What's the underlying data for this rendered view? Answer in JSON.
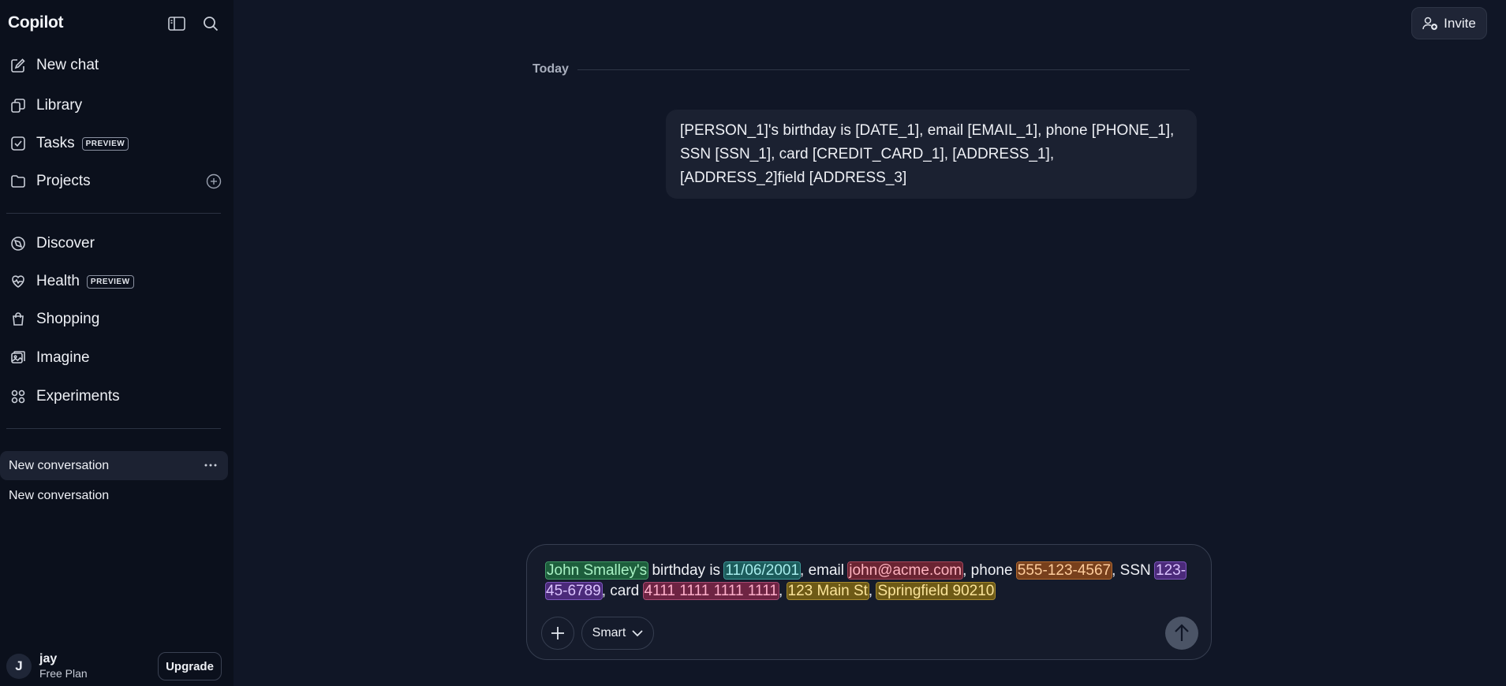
{
  "sidebar": {
    "brand": "Copilot",
    "top_icons": [
      "sidebar-toggle-icon",
      "search-icon"
    ],
    "nav": [
      {
        "label": "New chat",
        "icon": "compose-icon"
      },
      {
        "label": "Library",
        "icon": "library-icon"
      },
      {
        "label": "Tasks",
        "icon": "tasks-icon",
        "badge": "PREVIEW"
      },
      {
        "label": "Projects",
        "icon": "folder-icon"
      },
      {
        "label": "Discover",
        "icon": "compass-icon"
      },
      {
        "label": "Health",
        "icon": "heart-icon",
        "badge": "PREVIEW"
      },
      {
        "label": "Shopping",
        "icon": "shopping-bag-icon"
      },
      {
        "label": "Imagine",
        "icon": "image-icon"
      },
      {
        "label": "Experiments",
        "icon": "experiments-icon"
      }
    ],
    "conversations": [
      {
        "label": "New conversation",
        "active": true
      },
      {
        "label": "New conversation",
        "active": false
      }
    ],
    "user": {
      "initial": "J",
      "name": "jay",
      "plan": "Free Plan"
    },
    "upgrade_label": "Upgrade"
  },
  "header": {
    "invite_label": "Invite"
  },
  "chat": {
    "date_divider": "Today",
    "messages": [
      {
        "role": "user",
        "text": "[PERSON_1]'s birthday is [DATE_1], email [EMAIL_1], phone [PHONE_1], SSN [SSN_1], card [CREDIT_CARD_1], [ADDRESS_1], [ADDRESS_2]field [ADDRESS_3]"
      }
    ]
  },
  "composer": {
    "segments": [
      {
        "text": "John Smalley's",
        "entity": "person"
      },
      {
        "text": " birthday is ",
        "entity": null
      },
      {
        "text": "11/06/2001",
        "entity": "date"
      },
      {
        "text": ", email ",
        "entity": null
      },
      {
        "text": "john@acme.com",
        "entity": "email"
      },
      {
        "text": ", phone ",
        "entity": null
      },
      {
        "text": "555-123-4567",
        "entity": "phone"
      },
      {
        "text": ", SSN ",
        "entity": null
      },
      {
        "text": "123-45-6789",
        "entity": "ssn"
      },
      {
        "text": ", card ",
        "entity": null
      },
      {
        "text": "4111 1111 1111 1111",
        "entity": "card"
      },
      {
        "text": ", ",
        "entity": null
      },
      {
        "text": "123 Main St",
        "entity": "addr"
      },
      {
        "text": ", ",
        "entity": null
      },
      {
        "text": "Springfield 90210",
        "entity": "addr"
      }
    ],
    "mode_label": "Smart",
    "colors": {
      "send_button": "#4b5466",
      "background": "#151b2b"
    }
  }
}
